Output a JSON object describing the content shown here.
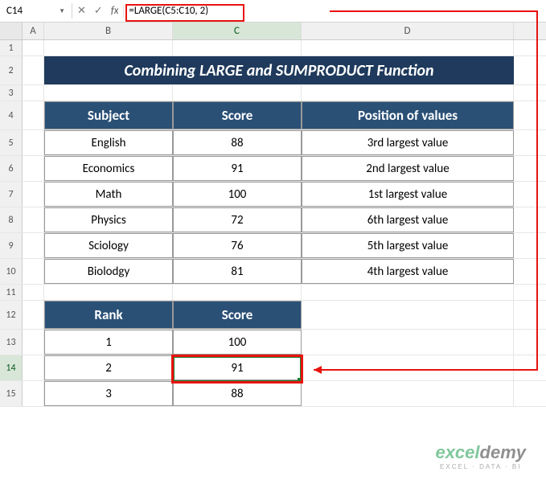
{
  "nameBox": "C14",
  "formula": "=LARGE(C5:C10, 2)",
  "columns": {
    "A": "A",
    "B": "B",
    "C": "C",
    "D": "D"
  },
  "title": "Combining LARGE and SUMPRODUCT Function",
  "table1": {
    "headers": {
      "subject": "Subject",
      "score": "Score",
      "position": "Position of values"
    },
    "rows": [
      {
        "subject": "English",
        "score": "88",
        "position": "3rd largest value"
      },
      {
        "subject": "Economics",
        "score": "91",
        "position": "2nd largest value"
      },
      {
        "subject": "Math",
        "score": "100",
        "position": "1st largest value"
      },
      {
        "subject": "Physics",
        "score": "72",
        "position": "6th largest value"
      },
      {
        "subject": "Sciology",
        "score": "76",
        "position": "5th largest value"
      },
      {
        "subject": "Biolodgy",
        "score": "81",
        "position": "4th largest value"
      }
    ]
  },
  "table2": {
    "headers": {
      "rank": "Rank",
      "score": "Score"
    },
    "rows": [
      {
        "rank": "1",
        "score": "100"
      },
      {
        "rank": "2",
        "score": "91"
      },
      {
        "rank": "3",
        "score": "88"
      }
    ]
  },
  "rowNums": [
    "1",
    "2",
    "3",
    "4",
    "5",
    "6",
    "7",
    "8",
    "9",
    "10",
    "11",
    "12",
    "13",
    "14",
    "15"
  ],
  "watermark": {
    "brand1": "excel",
    "brand2": "demy",
    "tag": "EXCEL · DATA · BI"
  }
}
